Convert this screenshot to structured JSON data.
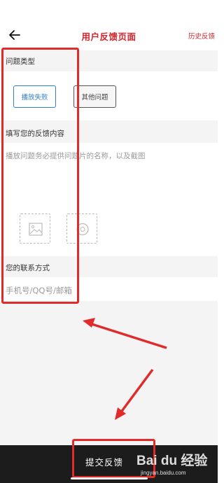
{
  "header": {
    "title": "用户反馈页面",
    "history_link": "历史反馈",
    "back_icon": "back-arrow-icon"
  },
  "problem_type": {
    "label": "问题类型",
    "options": [
      {
        "label": "播放失败",
        "selected": true
      },
      {
        "label": "其他问题",
        "selected": false
      }
    ]
  },
  "feedback": {
    "label": "填写您的反馈内容",
    "placeholder": "播放问题务必提供问题片的名称，以及截图",
    "upload_icons": [
      "image-upload-icon",
      "video-upload-icon"
    ]
  },
  "contact": {
    "label": "您的联系方式",
    "placeholder": "手机号/QQ号/邮箱"
  },
  "footer": {
    "submit_label": "提交反馈"
  },
  "watermark": {
    "logo_text": "Bai du 经验",
    "url": "jingyan.baidu.com"
  },
  "colors": {
    "accent_red": "#d4232a",
    "selected_blue": "#2f7fcf",
    "annotation_red": "#e02b2b",
    "bottom_bar": "#1c1c1c"
  }
}
